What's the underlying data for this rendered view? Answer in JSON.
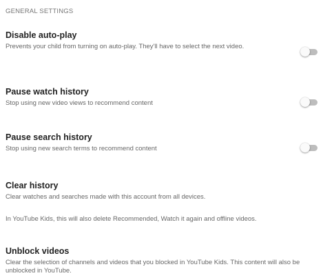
{
  "section": {
    "header": "GENERAL SETTINGS"
  },
  "settings": {
    "autoplay": {
      "title": "Disable auto-play",
      "description": "Prevents your child from turning on auto-play. They'll have to select the next video.",
      "toggle_on": false
    },
    "watch_history": {
      "title": "Pause watch history",
      "description": "Stop using new video views to recommend content",
      "toggle_on": false
    },
    "search_history": {
      "title": "Pause search history",
      "description": "Stop using new search terms to recommend content",
      "toggle_on": false
    },
    "clear_history": {
      "title": "Clear history",
      "description": "Clear watches and searches made with this account from all devices.",
      "note": "In YouTube Kids, this will also delete Recommended, Watch it again and offline videos."
    },
    "unblock_videos": {
      "title": "Unblock videos",
      "description": "Clear the selection of channels and videos that you blocked in YouTube Kids. This content will also be unblocked in YouTube."
    }
  },
  "colors": {
    "toggle_track_off": "#bdbdbd",
    "toggle_knob_off": "#fafafa",
    "title_text": "#212121",
    "secondary_text": "#666666"
  }
}
